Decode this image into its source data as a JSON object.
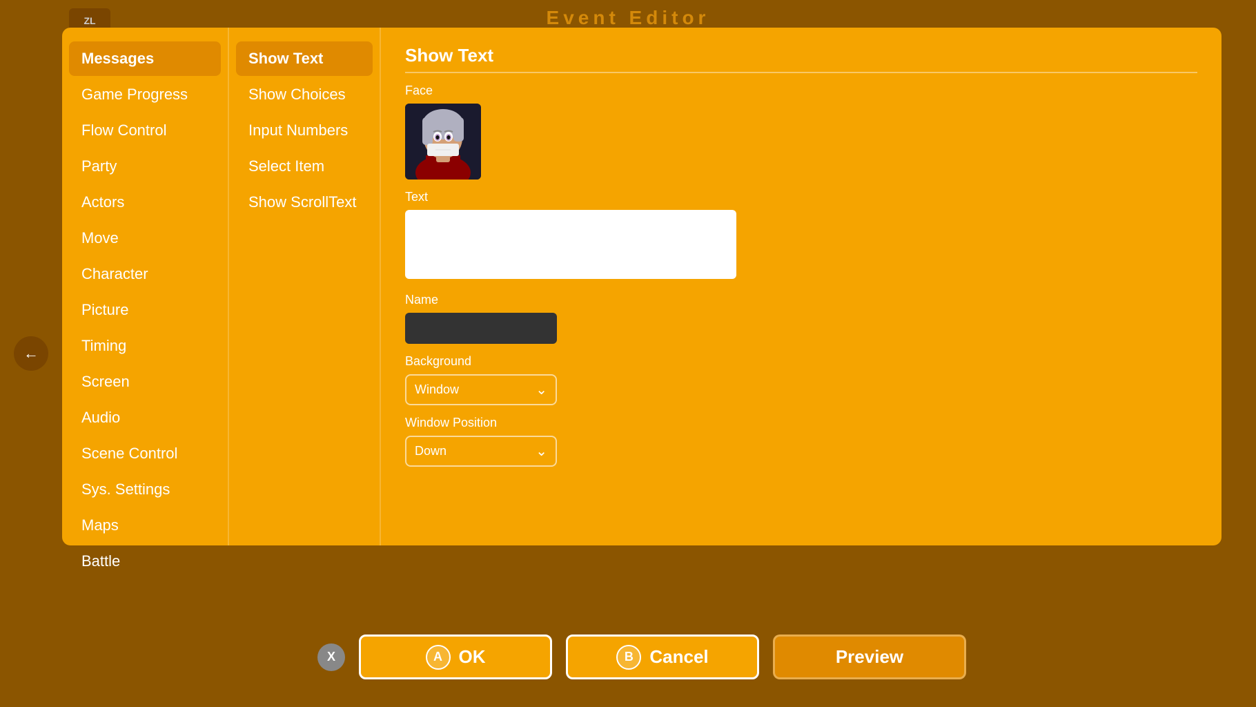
{
  "title": "Event Editor",
  "topLeftIcon": "ZL",
  "sidebar": {
    "items": [
      {
        "label": "Messages",
        "active": true
      },
      {
        "label": "Game Progress",
        "active": false
      },
      {
        "label": "Flow Control",
        "active": false
      },
      {
        "label": "Party",
        "active": false
      },
      {
        "label": "Actors",
        "active": false
      },
      {
        "label": "Move",
        "active": false
      },
      {
        "label": "Character",
        "active": false
      },
      {
        "label": "Picture",
        "active": false
      },
      {
        "label": "Timing",
        "active": false
      },
      {
        "label": "Screen",
        "active": false
      },
      {
        "label": "Audio",
        "active": false
      },
      {
        "label": "Scene Control",
        "active": false
      },
      {
        "label": "Sys. Settings",
        "active": false
      },
      {
        "label": "Maps",
        "active": false
      },
      {
        "label": "Battle",
        "active": false
      }
    ]
  },
  "middle": {
    "items": [
      {
        "label": "Show Text",
        "active": true
      },
      {
        "label": "Show Choices",
        "active": false
      },
      {
        "label": "Input Numbers",
        "active": false
      },
      {
        "label": "Select Item",
        "active": false
      },
      {
        "label": "Show ScrollText",
        "active": false
      }
    ]
  },
  "content": {
    "title": "Show Text",
    "face_label": "Face",
    "text_label": "Text",
    "text_value": "",
    "name_label": "Name",
    "name_value": "",
    "background_label": "Background",
    "background_value": "Window",
    "window_position_label": "Window Position",
    "window_position_value": "Down"
  },
  "buttons": {
    "x_label": "X",
    "ok_badge": "A",
    "ok_label": "OK",
    "cancel_badge": "B",
    "cancel_label": "Cancel",
    "preview_label": "Preview"
  }
}
